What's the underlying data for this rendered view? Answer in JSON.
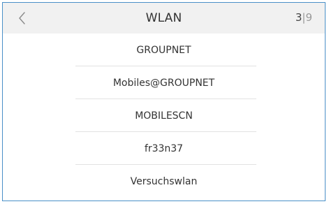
{
  "header": {
    "title": "WLAN",
    "page_current": "3",
    "page_separator": "|",
    "page_total": "9",
    "back_icon": "chevron-left-icon"
  },
  "networks": [
    {
      "label": "GROUPNET"
    },
    {
      "label": "Mobiles@GROUPNET"
    },
    {
      "label": "MOBILESCN"
    },
    {
      "label": "fr33n37"
    },
    {
      "label": "Versuchswlan"
    }
  ],
  "colors": {
    "header_bg": "#f1f1f1",
    "frame_border": "#4a90c8",
    "text": "#333333",
    "divider": "#e2e2e2"
  }
}
